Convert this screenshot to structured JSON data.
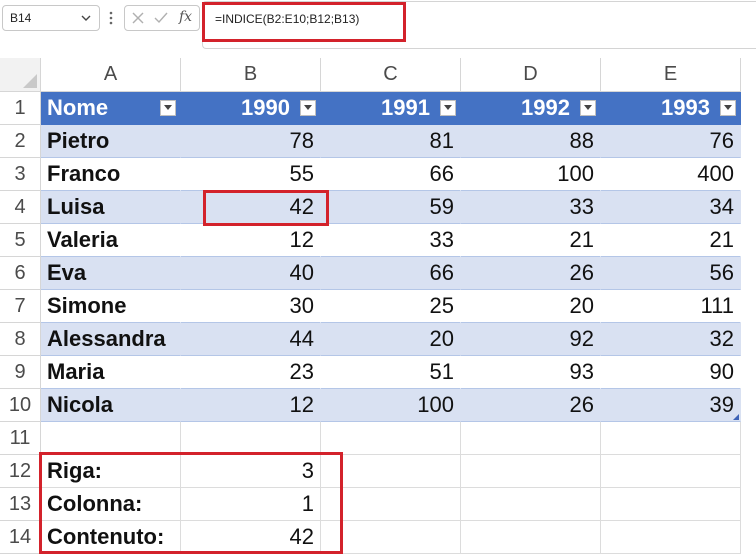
{
  "formula_bar": {
    "name_box": "B14",
    "fx_label": "fx",
    "formula": "=INDICE(B2:E10;B12;B13)"
  },
  "columns": [
    "A",
    "B",
    "C",
    "D",
    "E"
  ],
  "rows": [
    "1",
    "2",
    "3",
    "4",
    "5",
    "6",
    "7",
    "8",
    "9",
    "10",
    "11",
    "12",
    "13",
    "14"
  ],
  "table": {
    "headers": [
      "Nome",
      "1990",
      "1991",
      "1992",
      "1993"
    ],
    "rows": [
      [
        "Pietro",
        "78",
        "81",
        "88",
        "76"
      ],
      [
        "Franco",
        "55",
        "66",
        "100",
        "400"
      ],
      [
        "Luisa",
        "42",
        "59",
        "33",
        "34"
      ],
      [
        "Valeria",
        "12",
        "33",
        "21",
        "21"
      ],
      [
        "Eva",
        "40",
        "66",
        "26",
        "56"
      ],
      [
        "Simone",
        "30",
        "25",
        "20",
        "111"
      ],
      [
        "Alessandra",
        "44",
        "20",
        "92",
        "32"
      ],
      [
        "Maria",
        "23",
        "51",
        "93",
        "90"
      ],
      [
        "Nicola",
        "12",
        "100",
        "26",
        "39"
      ]
    ]
  },
  "lookup": [
    {
      "label": "Riga:",
      "value": "3"
    },
    {
      "label": "Colonna:",
      "value": "1"
    },
    {
      "label": "Contenuto:",
      "value": "42"
    }
  ],
  "colors": {
    "table_header": "#4472c4",
    "band": "#d9e1f2",
    "highlight": "#d3222b"
  }
}
